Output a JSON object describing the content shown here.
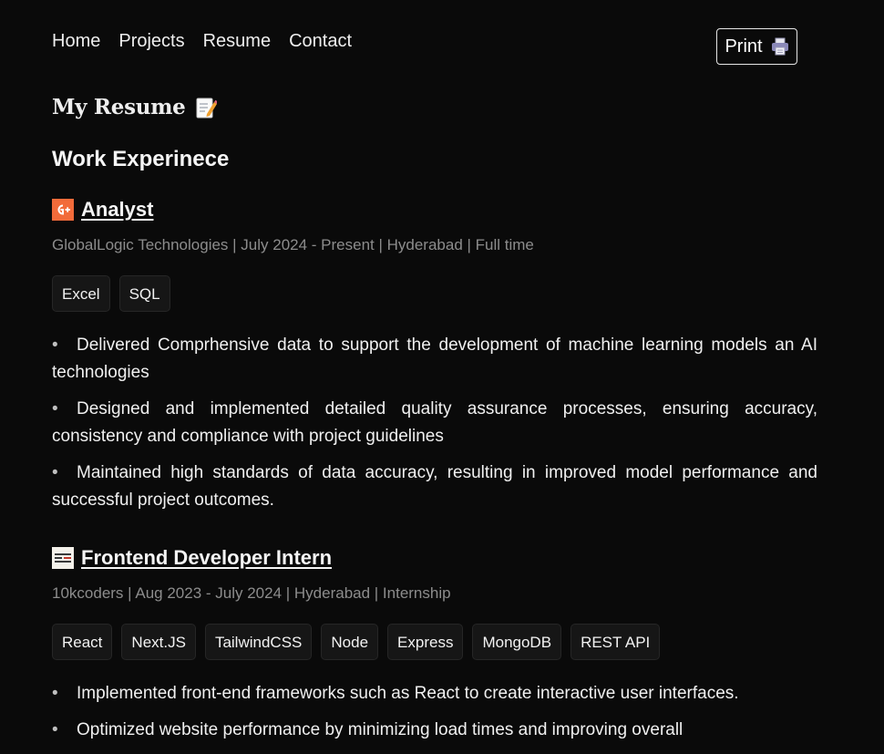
{
  "nav": {
    "items": [
      "Home",
      "Projects",
      "Resume",
      "Contact"
    ],
    "print_label": "Print"
  },
  "page_title": "My Resume",
  "section_title": "Work Experinece",
  "jobs": [
    {
      "title": "Analyst",
      "meta": "GlobalLogic Technologies | July 2024 - Present | Hyderabad | Full time",
      "tags": [
        "Excel",
        "SQL"
      ],
      "bullets": [
        "Delivered Comprhensive data to support the development of machine learning models an AI technologies",
        "Designed and implemented detailed quality assurance processes, ensuring accuracy, consistency and compliance with project guidelines",
        "Maintained high standards of data accuracy, resulting in improved model performance and successful project outcomes."
      ]
    },
    {
      "title": "Frontend Developer Intern",
      "meta": "10kcoders | Aug 2023 - July 2024 | Hyderabad | Internship",
      "tags": [
        "React",
        "Next.JS",
        "TailwindCSS",
        "Node",
        "Express",
        "MongoDB",
        "REST API"
      ],
      "bullets": [
        "Implemented front-end frameworks such as React to create interactive user interfaces.",
        "Optimized website performance by minimizing load times and improving overall"
      ]
    }
  ],
  "colors": {
    "background": "#0a0a0a",
    "meta_text": "#8c8c8c",
    "globallogic_logo": "#f26b3a"
  },
  "icons": {
    "print": "printer-icon",
    "title": "memo-icon",
    "job0_logo": "globallogic-logo",
    "job1_logo": "10kcoders-logo"
  }
}
